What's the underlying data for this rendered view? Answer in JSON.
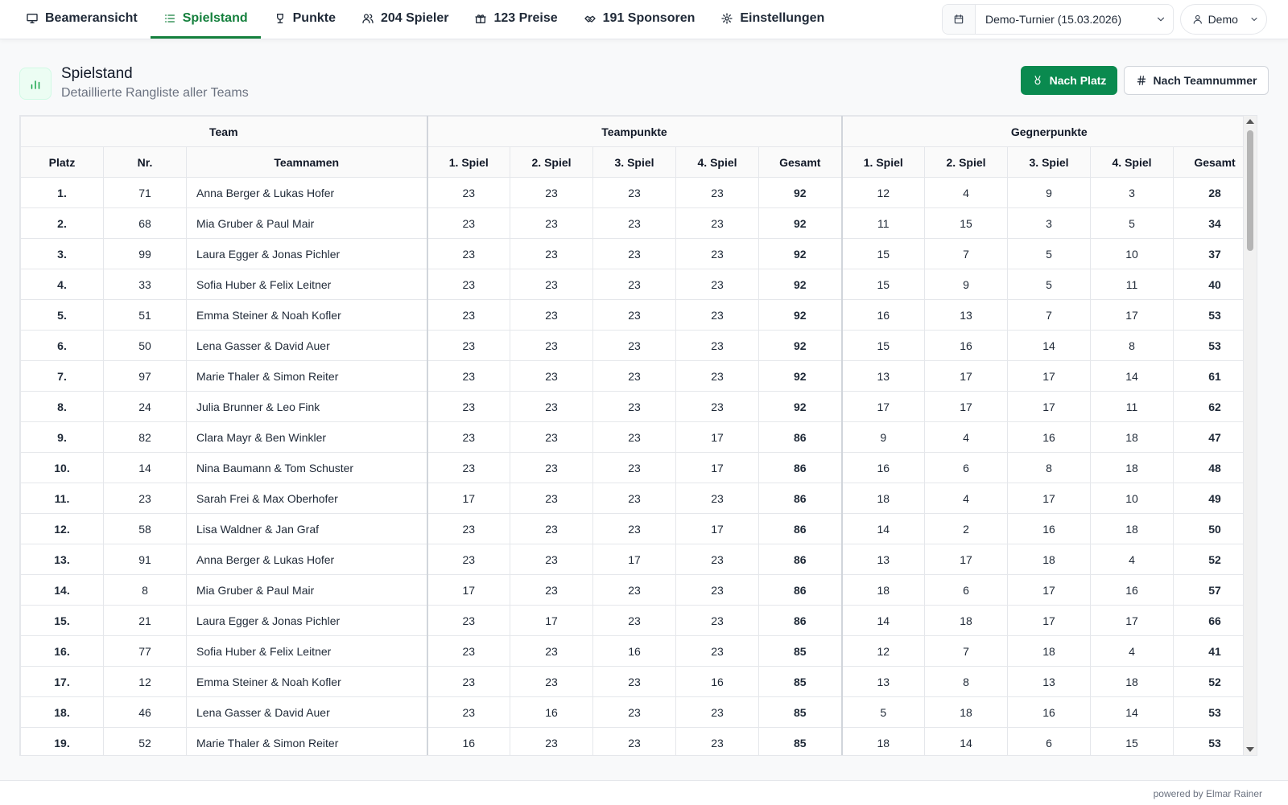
{
  "nav": {
    "items": [
      {
        "label": "Beameransicht",
        "icon": "monitor-icon"
      },
      {
        "label": "Spielstand",
        "icon": "list-icon",
        "active": true
      },
      {
        "label": "Punkte",
        "icon": "trophy-icon"
      },
      {
        "label": "204 Spieler",
        "icon": "users-icon"
      },
      {
        "label": "123 Preise",
        "icon": "gift-icon"
      },
      {
        "label": "191 Sponsoren",
        "icon": "handshake-icon"
      },
      {
        "label": "Einstellungen",
        "icon": "gear-icon"
      }
    ],
    "tournament": "Demo-Turnier (15.03.2026)",
    "user": "Demo"
  },
  "header": {
    "title": "Spielstand",
    "subtitle": "Detaillierte Rangliste aller Teams",
    "sort_place_label": "Nach Platz",
    "sort_team_label": "Nach Teamnummer"
  },
  "table": {
    "groups": [
      "Team",
      "Teampunkte",
      "Gegnerpunkte"
    ],
    "columns": [
      "Platz",
      "Nr.",
      "Teamnamen",
      "1. Spiel",
      "2. Spiel",
      "3. Spiel",
      "4. Spiel",
      "Gesamt",
      "1. Spiel",
      "2. Spiel",
      "3. Spiel",
      "4. Spiel",
      "Gesamt"
    ],
    "rows": [
      [
        "1.",
        "71",
        "Anna Berger & Lukas Hofer",
        "23",
        "23",
        "23",
        "23",
        "92",
        "12",
        "4",
        "9",
        "3",
        "28"
      ],
      [
        "2.",
        "68",
        "Mia Gruber & Paul Mair",
        "23",
        "23",
        "23",
        "23",
        "92",
        "11",
        "15",
        "3",
        "5",
        "34"
      ],
      [
        "3.",
        "99",
        "Laura Egger & Jonas Pichler",
        "23",
        "23",
        "23",
        "23",
        "92",
        "15",
        "7",
        "5",
        "10",
        "37"
      ],
      [
        "4.",
        "33",
        "Sofia Huber & Felix Leitner",
        "23",
        "23",
        "23",
        "23",
        "92",
        "15",
        "9",
        "5",
        "11",
        "40"
      ],
      [
        "5.",
        "51",
        "Emma Steiner & Noah Kofler",
        "23",
        "23",
        "23",
        "23",
        "92",
        "16",
        "13",
        "7",
        "17",
        "53"
      ],
      [
        "6.",
        "50",
        "Lena Gasser & David Auer",
        "23",
        "23",
        "23",
        "23",
        "92",
        "15",
        "16",
        "14",
        "8",
        "53"
      ],
      [
        "7.",
        "97",
        "Marie Thaler & Simon Reiter",
        "23",
        "23",
        "23",
        "23",
        "92",
        "13",
        "17",
        "17",
        "14",
        "61"
      ],
      [
        "8.",
        "24",
        "Julia Brunner & Leo Fink",
        "23",
        "23",
        "23",
        "23",
        "92",
        "17",
        "17",
        "17",
        "11",
        "62"
      ],
      [
        "9.",
        "82",
        "Clara Mayr & Ben Winkler",
        "23",
        "23",
        "23",
        "17",
        "86",
        "9",
        "4",
        "16",
        "18",
        "47"
      ],
      [
        "10.",
        "14",
        "Nina Baumann & Tom Schuster",
        "23",
        "23",
        "23",
        "17",
        "86",
        "16",
        "6",
        "8",
        "18",
        "48"
      ],
      [
        "11.",
        "23",
        "Sarah Frei & Max Oberhofer",
        "17",
        "23",
        "23",
        "23",
        "86",
        "18",
        "4",
        "17",
        "10",
        "49"
      ],
      [
        "12.",
        "58",
        "Lisa Waldner & Jan Graf",
        "23",
        "23",
        "23",
        "17",
        "86",
        "14",
        "2",
        "16",
        "18",
        "50"
      ],
      [
        "13.",
        "91",
        "Anna Berger & Lukas Hofer",
        "23",
        "23",
        "17",
        "23",
        "86",
        "13",
        "17",
        "18",
        "4",
        "52"
      ],
      [
        "14.",
        "8",
        "Mia Gruber & Paul Mair",
        "17",
        "23",
        "23",
        "23",
        "86",
        "18",
        "6",
        "17",
        "16",
        "57"
      ],
      [
        "15.",
        "21",
        "Laura Egger & Jonas Pichler",
        "23",
        "17",
        "23",
        "23",
        "86",
        "14",
        "18",
        "17",
        "17",
        "66"
      ],
      [
        "16.",
        "77",
        "Sofia Huber & Felix Leitner",
        "23",
        "23",
        "16",
        "23",
        "85",
        "12",
        "7",
        "18",
        "4",
        "41"
      ],
      [
        "17.",
        "12",
        "Emma Steiner & Noah Kofler",
        "23",
        "23",
        "23",
        "16",
        "85",
        "13",
        "8",
        "13",
        "18",
        "52"
      ],
      [
        "18.",
        "46",
        "Lena Gasser & David Auer",
        "23",
        "16",
        "23",
        "23",
        "85",
        "5",
        "18",
        "16",
        "14",
        "53"
      ],
      [
        "19.",
        "52",
        "Marie Thaler & Simon Reiter",
        "16",
        "23",
        "23",
        "23",
        "85",
        "18",
        "14",
        "6",
        "15",
        "53"
      ]
    ]
  },
  "footer": {
    "text": "powered by Elmar Rainer"
  },
  "colors": {
    "accent": "#15803d",
    "primary_button": "#0a8a4f"
  }
}
